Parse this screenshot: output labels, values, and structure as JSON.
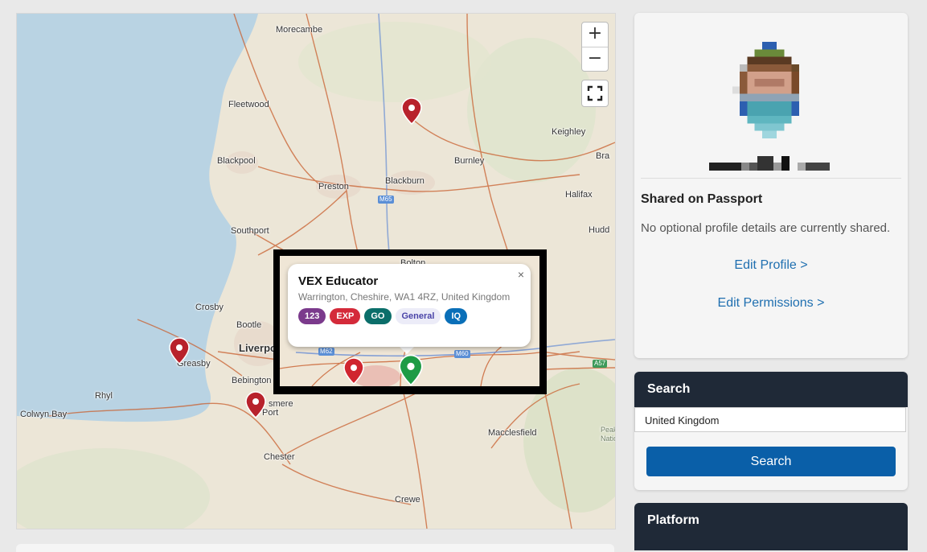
{
  "map": {
    "towns": [
      {
        "name": "Morecambe",
        "big": false
      },
      {
        "name": "Fleetwood",
        "big": false
      },
      {
        "name": "Blackpool",
        "big": false
      },
      {
        "name": "Preston",
        "big": false
      },
      {
        "name": "Blackburn",
        "big": false
      },
      {
        "name": "Burnley",
        "big": false
      },
      {
        "name": "Keighley",
        "big": false
      },
      {
        "name": "Halifax",
        "big": false
      },
      {
        "name": "Southport",
        "big": false
      },
      {
        "name": "Crosby",
        "big": false
      },
      {
        "name": "Bootle",
        "big": false
      },
      {
        "name": "Liverpool",
        "big": true
      },
      {
        "name": "Greasby",
        "big": false
      },
      {
        "name": "Bebington",
        "big": false
      },
      {
        "name": "Rhyl",
        "big": false
      },
      {
        "name": "Colwyn Bay",
        "big": false
      },
      {
        "name": "Chester",
        "big": false
      },
      {
        "name": "Crewe",
        "big": false
      },
      {
        "name": "Macclesfield",
        "big": false
      },
      {
        "name": "Bra",
        "big": false
      },
      {
        "name": "Hudd",
        "big": false
      },
      {
        "name": "Peak Dist",
        "big": false
      },
      {
        "name": "National P",
        "big": false
      },
      {
        "name": "smere",
        "big": false
      },
      {
        "name": "Port",
        "big": false
      },
      {
        "name": "Bolton",
        "big": false
      }
    ],
    "road_badges": [
      "M65",
      "M62",
      "M60",
      "A57"
    ],
    "zoom_in": "+",
    "zoom_out": "−"
  },
  "popup": {
    "title": "VEX Educator",
    "address": "Warrington, Cheshire, WA1 4RZ, United Kingdom",
    "close": "×",
    "tags": [
      {
        "label": "123",
        "color": "#7b3a8c",
        "text_color": "#ffffff"
      },
      {
        "label": "EXP",
        "color": "#d42a3a",
        "text_color": "#ffffff"
      },
      {
        "label": "GO",
        "color": "#0b6e6a",
        "text_color": "#ffffff"
      },
      {
        "label": "General",
        "color": "#ececf8",
        "text_color": "#4a44a8"
      },
      {
        "label": "IQ",
        "color": "#0a6fb8",
        "text_color": "#ffffff"
      }
    ]
  },
  "profile": {
    "shared_title": "Shared on Passport",
    "shared_text": "No optional profile details are currently shared.",
    "edit_profile": "Edit Profile >",
    "edit_permissions": "Edit Permissions >"
  },
  "search": {
    "header": "Search",
    "value": "United Kingdom",
    "button": "Search"
  },
  "platform": {
    "header": "Platform"
  },
  "colors": {
    "accent": "#0a5fa8",
    "header_bg": "#1f2937",
    "pin_red": "#d0252f",
    "pin_green": "#1e9b45"
  }
}
